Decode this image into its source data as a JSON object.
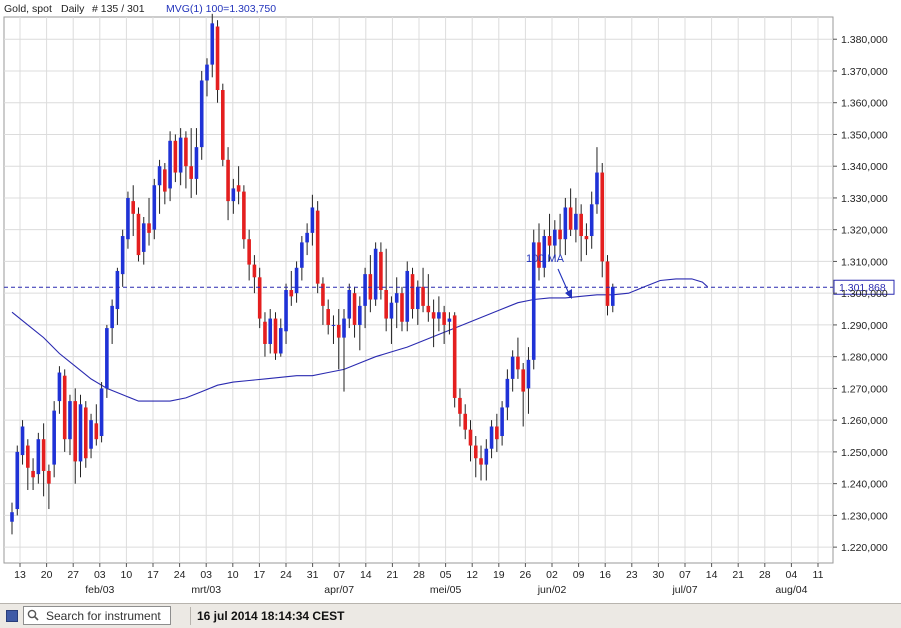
{
  "header": {
    "instrument": "Gold, spot",
    "period": "Daily",
    "bar_info": "# 135 / 301",
    "indicator": "MVG(1) 100=1.303,750"
  },
  "current_price_label": "1.301,868",
  "annotation": "100 MA",
  "status": {
    "search_placeholder": "Search for instrument",
    "timestamp": "16 jul 2014 18:14:34 CEST"
  },
  "colors": {
    "up": "#1f32d6",
    "down": "#e41f1f",
    "ma": "#2a2ab0",
    "grid": "#dcdcdc"
  },
  "chart_data": {
    "type": "candlestick",
    "y_axis": {
      "range": [
        1215,
        1387
      ],
      "ticks": [
        "1.220,000",
        "1.230,000",
        "1.240,000",
        "1.250,000",
        "1.260,000",
        "1.270,000",
        "1.280,000",
        "1.290,000",
        "1.300,000",
        "1.310,000",
        "1.320,000",
        "1.330,000",
        "1.340,000",
        "1.350,000",
        "1.360,000",
        "1.370,000",
        "1.380,000"
      ],
      "tick_values": [
        1220,
        1230,
        1240,
        1250,
        1260,
        1270,
        1280,
        1290,
        1300,
        1310,
        1320,
        1330,
        1340,
        1350,
        1360,
        1370,
        1380
      ]
    },
    "x_axis": {
      "day_ticks": [
        "13",
        "20",
        "27",
        "03",
        "10",
        "17",
        "24",
        "03",
        "10",
        "17",
        "24",
        "31",
        "07",
        "14",
        "21",
        "28",
        "05",
        "12",
        "19",
        "26",
        "02",
        "09",
        "16",
        "23",
        "30",
        "07",
        "14",
        "21",
        "28",
        "04",
        "11"
      ],
      "month_labels": [
        {
          "label": "feb/03",
          "tick": 3
        },
        {
          "label": "mrt/03",
          "tick": 7
        },
        {
          "label": "apr/07",
          "tick": 12
        },
        {
          "label": "mei/05",
          "tick": 16
        },
        {
          "label": "jun/02",
          "tick": 20
        },
        {
          "label": "jul/07",
          "tick": 25
        },
        {
          "label": "aug/04",
          "tick": 29
        }
      ]
    },
    "current_price": 1301.868,
    "candles": [
      {
        "o": 1228,
        "h": 1234,
        "l": 1224,
        "c": 1231
      },
      {
        "o": 1232,
        "h": 1252,
        "l": 1230,
        "c": 1250
      },
      {
        "o": 1249,
        "h": 1260,
        "l": 1246,
        "c": 1258
      },
      {
        "o": 1252,
        "h": 1254,
        "l": 1238,
        "c": 1245
      },
      {
        "o": 1244,
        "h": 1248,
        "l": 1238,
        "c": 1242
      },
      {
        "o": 1243,
        "h": 1256,
        "l": 1240,
        "c": 1254
      },
      {
        "o": 1254,
        "h": 1259,
        "l": 1236,
        "c": 1244
      },
      {
        "o": 1244,
        "h": 1246,
        "l": 1232,
        "c": 1240
      },
      {
        "o": 1246,
        "h": 1266,
        "l": 1242,
        "c": 1263
      },
      {
        "o": 1266,
        "h": 1277,
        "l": 1262,
        "c": 1275
      },
      {
        "o": 1274,
        "h": 1276,
        "l": 1250,
        "c": 1254
      },
      {
        "o": 1254,
        "h": 1268,
        "l": 1249,
        "c": 1266
      },
      {
        "o": 1266,
        "h": 1270,
        "l": 1240,
        "c": 1247
      },
      {
        "o": 1247,
        "h": 1268,
        "l": 1242,
        "c": 1265
      },
      {
        "o": 1264,
        "h": 1266,
        "l": 1245,
        "c": 1248
      },
      {
        "o": 1251,
        "h": 1262,
        "l": 1248,
        "c": 1260
      },
      {
        "o": 1259,
        "h": 1265,
        "l": 1252,
        "c": 1254
      },
      {
        "o": 1255,
        "h": 1272,
        "l": 1253,
        "c": 1270
      },
      {
        "o": 1270,
        "h": 1290,
        "l": 1267,
        "c": 1289
      },
      {
        "o": 1289,
        "h": 1298,
        "l": 1284,
        "c": 1296
      },
      {
        "o": 1295,
        "h": 1308,
        "l": 1290,
        "c": 1307
      },
      {
        "o": 1306,
        "h": 1320,
        "l": 1302,
        "c": 1318
      },
      {
        "o": 1317,
        "h": 1332,
        "l": 1314,
        "c": 1330
      },
      {
        "o": 1329,
        "h": 1334,
        "l": 1318,
        "c": 1325
      },
      {
        "o": 1325,
        "h": 1327,
        "l": 1310,
        "c": 1312
      },
      {
        "o": 1313,
        "h": 1324,
        "l": 1309,
        "c": 1322
      },
      {
        "o": 1322,
        "h": 1330,
        "l": 1315,
        "c": 1319
      },
      {
        "o": 1320,
        "h": 1336,
        "l": 1317,
        "c": 1334
      },
      {
        "o": 1334,
        "h": 1342,
        "l": 1325,
        "c": 1340
      },
      {
        "o": 1339,
        "h": 1341,
        "l": 1328,
        "c": 1332
      },
      {
        "o": 1333,
        "h": 1351,
        "l": 1329,
        "c": 1348
      },
      {
        "o": 1348,
        "h": 1350,
        "l": 1335,
        "c": 1338
      },
      {
        "o": 1338,
        "h": 1352,
        "l": 1334,
        "c": 1349
      },
      {
        "o": 1349,
        "h": 1351,
        "l": 1333,
        "c": 1340
      },
      {
        "o": 1340,
        "h": 1352,
        "l": 1330,
        "c": 1336
      },
      {
        "o": 1336,
        "h": 1352,
        "l": 1331,
        "c": 1346
      },
      {
        "o": 1346,
        "h": 1370,
        "l": 1342,
        "c": 1367
      },
      {
        "o": 1367,
        "h": 1374,
        "l": 1362,
        "c": 1372
      },
      {
        "o": 1372,
        "h": 1388,
        "l": 1368,
        "c": 1385
      },
      {
        "o": 1384,
        "h": 1386,
        "l": 1360,
        "c": 1364
      },
      {
        "o": 1364,
        "h": 1366,
        "l": 1340,
        "c": 1342
      },
      {
        "o": 1342,
        "h": 1346,
        "l": 1323,
        "c": 1329
      },
      {
        "o": 1329,
        "h": 1336,
        "l": 1325,
        "c": 1333
      },
      {
        "o": 1334,
        "h": 1340,
        "l": 1328,
        "c": 1332
      },
      {
        "o": 1332,
        "h": 1334,
        "l": 1314,
        "c": 1317
      },
      {
        "o": 1317,
        "h": 1320,
        "l": 1304,
        "c": 1309
      },
      {
        "o": 1309,
        "h": 1312,
        "l": 1300,
        "c": 1305
      },
      {
        "o": 1305,
        "h": 1308,
        "l": 1289,
        "c": 1292
      },
      {
        "o": 1291,
        "h": 1294,
        "l": 1280,
        "c": 1284
      },
      {
        "o": 1284,
        "h": 1295,
        "l": 1281,
        "c": 1292
      },
      {
        "o": 1292,
        "h": 1294,
        "l": 1279,
        "c": 1281
      },
      {
        "o": 1281,
        "h": 1292,
        "l": 1280,
        "c": 1289
      },
      {
        "o": 1288,
        "h": 1303,
        "l": 1284,
        "c": 1301
      },
      {
        "o": 1301,
        "h": 1307,
        "l": 1296,
        "c": 1299
      },
      {
        "o": 1300,
        "h": 1310,
        "l": 1297,
        "c": 1308
      },
      {
        "o": 1308,
        "h": 1318,
        "l": 1304,
        "c": 1316
      },
      {
        "o": 1316,
        "h": 1322,
        "l": 1312,
        "c": 1319
      },
      {
        "o": 1319,
        "h": 1331,
        "l": 1315,
        "c": 1327
      },
      {
        "o": 1326,
        "h": 1329,
        "l": 1300,
        "c": 1303
      },
      {
        "o": 1303,
        "h": 1305,
        "l": 1290,
        "c": 1296
      },
      {
        "o": 1295,
        "h": 1298,
        "l": 1287,
        "c": 1290
      },
      {
        "o": 1290,
        "h": 1293,
        "l": 1284,
        "c": 1290
      },
      {
        "o": 1290,
        "h": 1295,
        "l": 1276,
        "c": 1286
      },
      {
        "o": 1286,
        "h": 1295,
        "l": 1269,
        "c": 1292
      },
      {
        "o": 1292,
        "h": 1303,
        "l": 1289,
        "c": 1301
      },
      {
        "o": 1300,
        "h": 1302,
        "l": 1286,
        "c": 1290
      },
      {
        "o": 1290,
        "h": 1299,
        "l": 1282,
        "c": 1296
      },
      {
        "o": 1296,
        "h": 1308,
        "l": 1289,
        "c": 1306
      },
      {
        "o": 1306,
        "h": 1312,
        "l": 1294,
        "c": 1298
      },
      {
        "o": 1298,
        "h": 1316,
        "l": 1296,
        "c": 1314
      },
      {
        "o": 1313,
        "h": 1316,
        "l": 1298,
        "c": 1301
      },
      {
        "o": 1301,
        "h": 1314,
        "l": 1288,
        "c": 1292
      },
      {
        "o": 1292,
        "h": 1299,
        "l": 1284,
        "c": 1297
      },
      {
        "o": 1297,
        "h": 1305,
        "l": 1289,
        "c": 1300
      },
      {
        "o": 1300,
        "h": 1302,
        "l": 1288,
        "c": 1291
      },
      {
        "o": 1291,
        "h": 1310,
        "l": 1288,
        "c": 1307
      },
      {
        "o": 1306,
        "h": 1308,
        "l": 1292,
        "c": 1295
      },
      {
        "o": 1295,
        "h": 1304,
        "l": 1290,
        "c": 1302
      },
      {
        "o": 1302,
        "h": 1308,
        "l": 1294,
        "c": 1296
      },
      {
        "o": 1296,
        "h": 1306,
        "l": 1291,
        "c": 1294
      },
      {
        "o": 1294,
        "h": 1298,
        "l": 1283,
        "c": 1292
      },
      {
        "o": 1292,
        "h": 1299,
        "l": 1288,
        "c": 1294
      },
      {
        "o": 1294,
        "h": 1296,
        "l": 1284,
        "c": 1290
      },
      {
        "o": 1291,
        "h": 1294,
        "l": 1287,
        "c": 1292
      },
      {
        "o": 1293,
        "h": 1294,
        "l": 1264,
        "c": 1267
      },
      {
        "o": 1267,
        "h": 1270,
        "l": 1258,
        "c": 1262
      },
      {
        "o": 1262,
        "h": 1265,
        "l": 1254,
        "c": 1257
      },
      {
        "o": 1257,
        "h": 1260,
        "l": 1247,
        "c": 1252
      },
      {
        "o": 1252,
        "h": 1255,
        "l": 1242,
        "c": 1248
      },
      {
        "o": 1248,
        "h": 1252,
        "l": 1241,
        "c": 1246
      },
      {
        "o": 1246,
        "h": 1254,
        "l": 1241,
        "c": 1251
      },
      {
        "o": 1251,
        "h": 1260,
        "l": 1248,
        "c": 1258
      },
      {
        "o": 1258,
        "h": 1262,
        "l": 1250,
        "c": 1254
      },
      {
        "o": 1255,
        "h": 1266,
        "l": 1252,
        "c": 1264
      },
      {
        "o": 1264,
        "h": 1276,
        "l": 1260,
        "c": 1273
      },
      {
        "o": 1273,
        "h": 1282,
        "l": 1269,
        "c": 1280
      },
      {
        "o": 1280,
        "h": 1286,
        "l": 1273,
        "c": 1276
      },
      {
        "o": 1276,
        "h": 1278,
        "l": 1258,
        "c": 1269
      },
      {
        "o": 1270,
        "h": 1283,
        "l": 1262,
        "c": 1279
      },
      {
        "o": 1279,
        "h": 1320,
        "l": 1276,
        "c": 1316
      },
      {
        "o": 1316,
        "h": 1322,
        "l": 1304,
        "c": 1308
      },
      {
        "o": 1308,
        "h": 1320,
        "l": 1305,
        "c": 1318
      },
      {
        "o": 1318,
        "h": 1325,
        "l": 1310,
        "c": 1315
      },
      {
        "o": 1315,
        "h": 1323,
        "l": 1311,
        "c": 1320
      },
      {
        "o": 1320,
        "h": 1325,
        "l": 1312,
        "c": 1317
      },
      {
        "o": 1317,
        "h": 1330,
        "l": 1312,
        "c": 1327
      },
      {
        "o": 1327,
        "h": 1333,
        "l": 1318,
        "c": 1320
      },
      {
        "o": 1320,
        "h": 1330,
        "l": 1316,
        "c": 1325
      },
      {
        "o": 1325,
        "h": 1328,
        "l": 1310,
        "c": 1318
      },
      {
        "o": 1318,
        "h": 1322,
        "l": 1312,
        "c": 1317
      },
      {
        "o": 1318,
        "h": 1332,
        "l": 1314,
        "c": 1328
      },
      {
        "o": 1328,
        "h": 1346,
        "l": 1325,
        "c": 1338
      },
      {
        "o": 1338,
        "h": 1341,
        "l": 1305,
        "c": 1310
      },
      {
        "o": 1310,
        "h": 1312,
        "l": 1293,
        "c": 1296
      },
      {
        "o": 1296,
        "h": 1303,
        "l": 1294,
        "c": 1302
      }
    ],
    "moving_average": {
      "name": "100 MA",
      "points": [
        [
          0,
          1294
        ],
        [
          3,
          1290
        ],
        [
          6,
          1286
        ],
        [
          9,
          1281
        ],
        [
          12,
          1277
        ],
        [
          15,
          1273
        ],
        [
          18,
          1270
        ],
        [
          21,
          1268
        ],
        [
          24,
          1266
        ],
        [
          27,
          1266
        ],
        [
          30,
          1266
        ],
        [
          33,
          1267
        ],
        [
          36,
          1269
        ],
        [
          39,
          1271
        ],
        [
          42,
          1272
        ],
        [
          45,
          1272.5
        ],
        [
          48,
          1273
        ],
        [
          51,
          1273.5
        ],
        [
          54,
          1274
        ],
        [
          57,
          1274
        ],
        [
          60,
          1275
        ],
        [
          63,
          1276
        ],
        [
          66,
          1278
        ],
        [
          69,
          1280
        ],
        [
          72,
          1281.5
        ],
        [
          75,
          1283
        ],
        [
          78,
          1285
        ],
        [
          81,
          1287
        ],
        [
          84,
          1289
        ],
        [
          87,
          1291
        ],
        [
          90,
          1293
        ],
        [
          93,
          1295
        ],
        [
          96,
          1297
        ],
        [
          99,
          1298
        ],
        [
          102,
          1298.5
        ],
        [
          105,
          1298.5
        ],
        [
          108,
          1299
        ],
        [
          111,
          1299.5
        ],
        [
          114,
          1299.5
        ],
        [
          117,
          1300
        ],
        [
          120,
          1302
        ],
        [
          123,
          1304
        ],
        [
          126,
          1304.5
        ],
        [
          129,
          1304.5
        ],
        [
          131,
          1303.5
        ],
        [
          132,
          1302
        ]
      ]
    }
  }
}
